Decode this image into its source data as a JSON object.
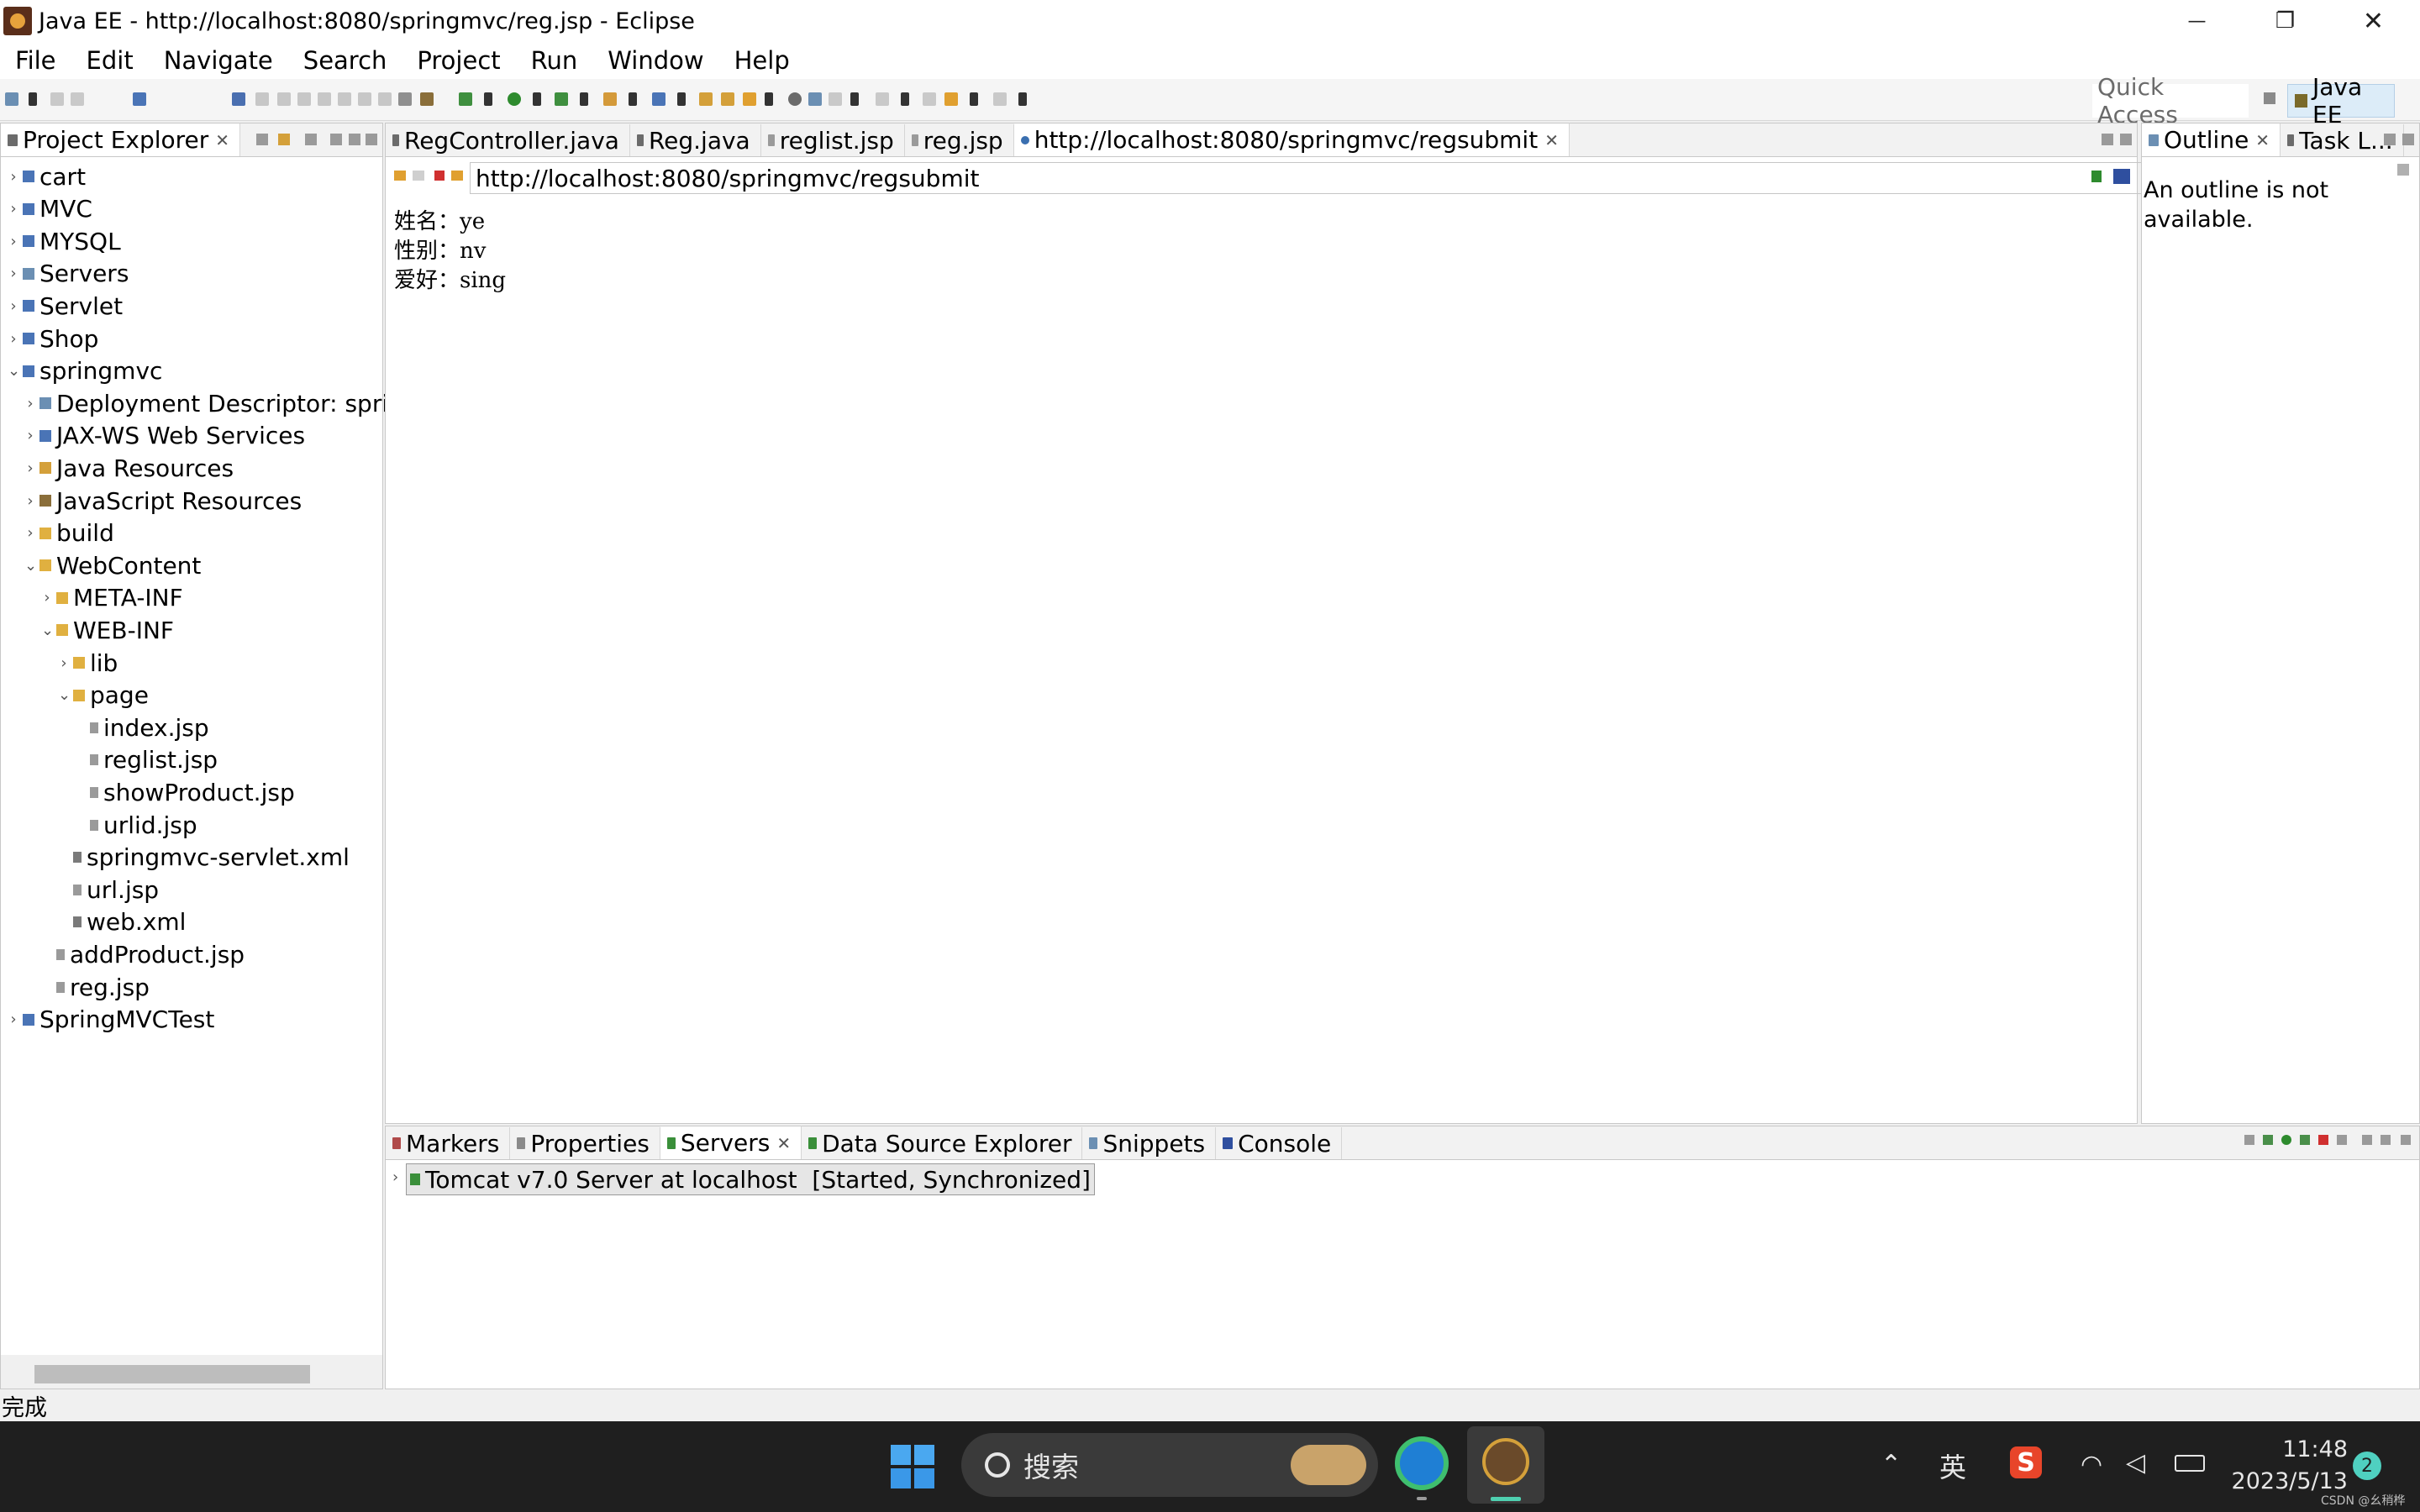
{
  "window": {
    "title": "Java EE - http://localhost:8080/springmvc/reg.jsp - Eclipse",
    "controls": {
      "minimize": "—",
      "maximize": "❐",
      "close": "✕"
    }
  },
  "menu": [
    "File",
    "Edit",
    "Navigate",
    "Search",
    "Project",
    "Run",
    "Window",
    "Help"
  ],
  "toolbar": {
    "quick_access": "Quick Access",
    "perspective": "Java EE"
  },
  "explorer": {
    "title": "Project Explorer",
    "close": "✕",
    "tree": [
      {
        "label": "cart",
        "level": 0,
        "expanded": false,
        "kind": "project"
      },
      {
        "label": "MVC",
        "level": 0,
        "expanded": false,
        "kind": "project"
      },
      {
        "label": "MYSQL",
        "level": 0,
        "expanded": false,
        "kind": "project"
      },
      {
        "label": "Servers",
        "level": 0,
        "expanded": false,
        "kind": "servers"
      },
      {
        "label": "Servlet",
        "level": 0,
        "expanded": false,
        "kind": "project"
      },
      {
        "label": "Shop",
        "level": 0,
        "expanded": false,
        "kind": "project"
      },
      {
        "label": "springmvc",
        "level": 0,
        "expanded": true,
        "kind": "project"
      },
      {
        "label": "Deployment Descriptor: springmvc",
        "level": 1,
        "expanded": false,
        "kind": "descriptor"
      },
      {
        "label": "JAX-WS Web Services",
        "level": 1,
        "expanded": false,
        "kind": "service"
      },
      {
        "label": "Java Resources",
        "level": 1,
        "expanded": false,
        "kind": "java"
      },
      {
        "label": "JavaScript Resources",
        "level": 1,
        "expanded": false,
        "kind": "js"
      },
      {
        "label": "build",
        "level": 1,
        "expanded": false,
        "kind": "folder"
      },
      {
        "label": "WebContent",
        "level": 1,
        "expanded": true,
        "kind": "folder"
      },
      {
        "label": "META-INF",
        "level": 2,
        "expanded": false,
        "kind": "folder"
      },
      {
        "label": "WEB-INF",
        "level": 2,
        "expanded": true,
        "kind": "folder"
      },
      {
        "label": "lib",
        "level": 3,
        "expanded": false,
        "kind": "folder"
      },
      {
        "label": "page",
        "level": 3,
        "expanded": true,
        "kind": "folder"
      },
      {
        "label": "index.jsp",
        "level": 4,
        "leaf": true,
        "kind": "file"
      },
      {
        "label": "reglist.jsp",
        "level": 4,
        "leaf": true,
        "kind": "file"
      },
      {
        "label": "showProduct.jsp",
        "level": 4,
        "leaf": true,
        "kind": "file"
      },
      {
        "label": "urlid.jsp",
        "level": 4,
        "leaf": true,
        "kind": "file"
      },
      {
        "label": "springmvc-servlet.xml",
        "level": 3,
        "leaf": true,
        "kind": "xml"
      },
      {
        "label": "url.jsp",
        "level": 3,
        "leaf": true,
        "kind": "file"
      },
      {
        "label": "web.xml",
        "level": 3,
        "leaf": true,
        "kind": "xml"
      },
      {
        "label": "addProduct.jsp",
        "level": 2,
        "leaf": true,
        "kind": "file"
      },
      {
        "label": "reg.jsp",
        "level": 2,
        "leaf": true,
        "kind": "file"
      },
      {
        "label": "SpringMVCTest",
        "level": 0,
        "expanded": false,
        "kind": "project"
      }
    ]
  },
  "editor": {
    "tabs": [
      {
        "label": "RegController.java",
        "active": false
      },
      {
        "label": "Reg.java",
        "active": false
      },
      {
        "label": "reglist.jsp",
        "active": false
      },
      {
        "label": "reg.jsp",
        "active": false
      },
      {
        "label": "http://localhost:8080/springmvc/regsubmit",
        "active": true
      }
    ],
    "url": "http://localhost:8080/springmvc/regsubmit",
    "page_lines": [
      "姓名：ye",
      "性别：nv",
      "爱好：sing"
    ]
  },
  "outline": {
    "tabs": [
      {
        "label": "Outline",
        "active": true
      },
      {
        "label": "Task L...",
        "active": false
      }
    ],
    "message": "An outline is not available."
  },
  "bottom": {
    "tabs": [
      {
        "label": "Markers",
        "active": false
      },
      {
        "label": "Properties",
        "active": false
      },
      {
        "label": "Servers",
        "active": true
      },
      {
        "label": "Data Source Explorer",
        "active": false
      },
      {
        "label": "Snippets",
        "active": false
      },
      {
        "label": "Console",
        "active": false
      }
    ],
    "server_entry": "Tomcat v7.0 Server at localhost  [Started, Synchronized]"
  },
  "status": {
    "text": "完成"
  },
  "taskbar": {
    "search_placeholder": "搜索",
    "ime": "英",
    "time": "11:48",
    "date": "2023/5/13",
    "notification_count": "2",
    "watermark": "CSDN @幺稍桦"
  }
}
